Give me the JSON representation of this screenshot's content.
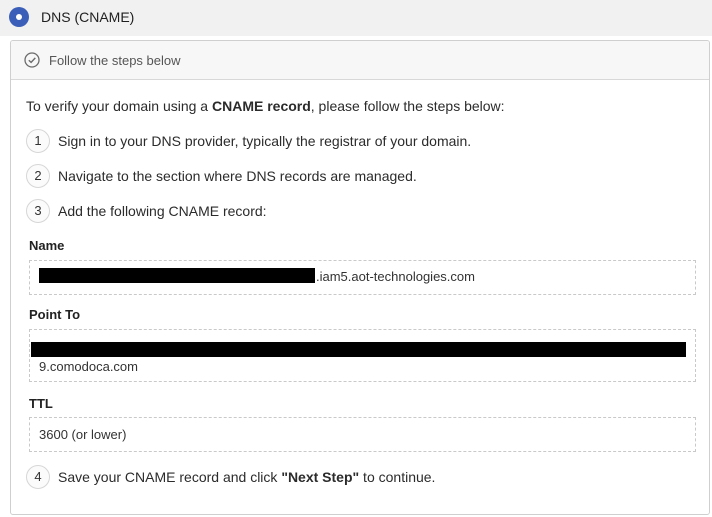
{
  "option": {
    "label": "DNS (CNAME)"
  },
  "panel": {
    "header_label": "Follow the steps below",
    "intro_prefix": "To verify your domain using a ",
    "intro_bold": "CNAME record",
    "intro_suffix": ", please follow the steps below:"
  },
  "steps": [
    {
      "num": "1",
      "text": "Sign in to your DNS provider, typically the registrar of your domain."
    },
    {
      "num": "2",
      "text": "Navigate to the section where DNS records are managed."
    },
    {
      "num": "3",
      "text": "Add the following CNAME record:"
    },
    {
      "num": "4",
      "prefix": "Save your CNAME record and click ",
      "bold": "\"Next Step\"",
      "suffix": " to continue."
    }
  ],
  "record": {
    "name_label": "Name",
    "name_value_visible": ".iam5.aot-technologies.com",
    "point_to_label": "Point To",
    "point_to_value_visible": "9.comodoca.com",
    "ttl_label": "TTL",
    "ttl_value": "3600 (or lower)"
  }
}
